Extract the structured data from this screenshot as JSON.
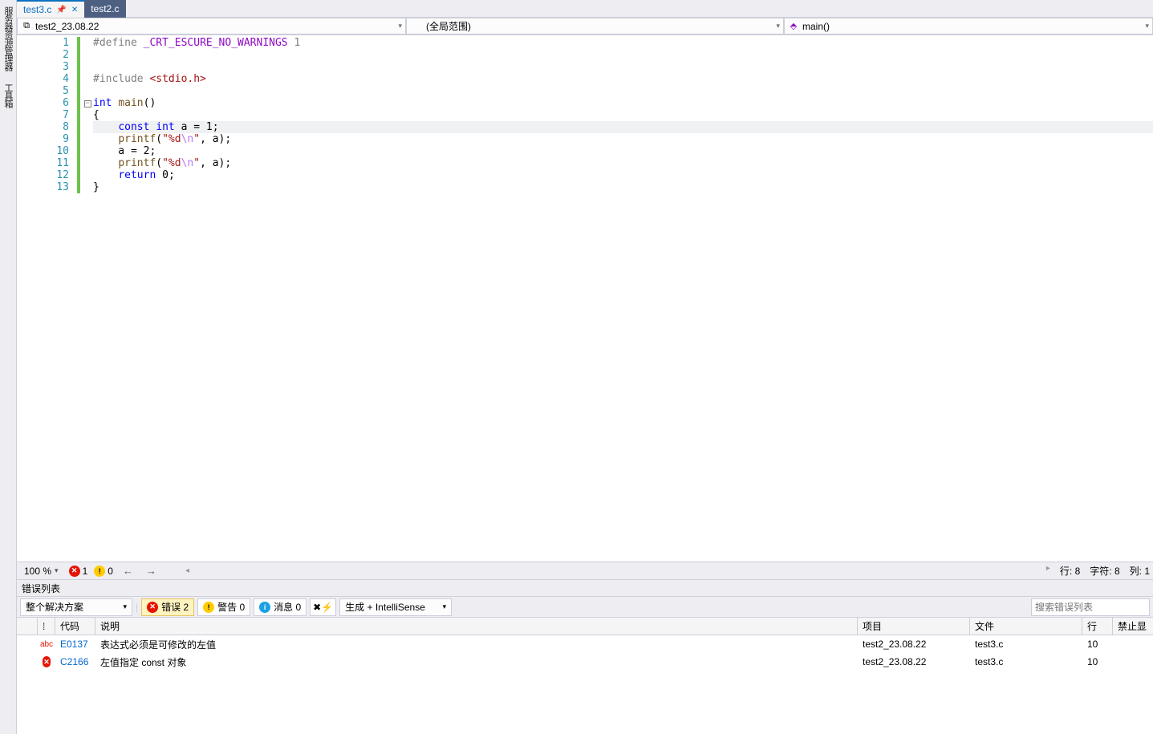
{
  "sidebar": {
    "tabs": [
      "服务器资源管理器",
      "工具箱"
    ]
  },
  "fileTabs": [
    {
      "label": "test3.c",
      "selected": true,
      "pinned": true
    },
    {
      "label": "test2.c",
      "selected": false
    }
  ],
  "nav": {
    "project": "test2_23.08.22",
    "scope": "(全局范围)",
    "member": "main()"
  },
  "code": {
    "lines": 13,
    "highlight": 8,
    "src": [
      {
        "t": [
          [
            "macro",
            "#define "
          ],
          [
            "pp",
            "_CRT_ESCURE_NO_WARNINGS"
          ],
          [
            "macro",
            " 1"
          ]
        ]
      },
      {
        "t": []
      },
      {
        "t": []
      },
      {
        "t": [
          [
            "macro",
            "#include "
          ],
          [
            "str",
            "<stdio.h>"
          ]
        ]
      },
      {
        "t": []
      },
      {
        "t": [
          [
            "kw",
            "int"
          ],
          [
            "txt",
            " "
          ],
          [
            "fn",
            "main"
          ],
          [
            "txt",
            "()"
          ]
        ]
      },
      {
        "t": [
          [
            "txt",
            "{"
          ]
        ]
      },
      {
        "t": [
          [
            "txt",
            "    "
          ],
          [
            "kw",
            "const"
          ],
          [
            "txt",
            " "
          ],
          [
            "kw",
            "int"
          ],
          [
            "txt",
            " a = "
          ],
          [
            "num",
            "1"
          ],
          [
            "txt",
            ";"
          ]
        ]
      },
      {
        "t": [
          [
            "txt",
            "    "
          ],
          [
            "fn",
            "printf"
          ],
          [
            "txt",
            "("
          ],
          [
            "str",
            "\"%d"
          ],
          [
            "esc",
            "\\n"
          ],
          [
            "str",
            "\""
          ],
          [
            "txt",
            ", a);"
          ]
        ]
      },
      {
        "t": [
          [
            "txt",
            "    a = "
          ],
          [
            "num",
            "2"
          ],
          [
            "txt",
            ";"
          ]
        ]
      },
      {
        "t": [
          [
            "txt",
            "    "
          ],
          [
            "fn",
            "printf"
          ],
          [
            "txt",
            "("
          ],
          [
            "str",
            "\"%d"
          ],
          [
            "esc",
            "\\n"
          ],
          [
            "str",
            "\""
          ],
          [
            "txt",
            ", a);"
          ]
        ]
      },
      {
        "t": [
          [
            "txt",
            "    "
          ],
          [
            "kw",
            "return"
          ],
          [
            "txt",
            " "
          ],
          [
            "num",
            "0"
          ],
          [
            "txt",
            ";"
          ]
        ]
      },
      {
        "t": [
          [
            "txt",
            "}"
          ]
        ]
      }
    ]
  },
  "status": {
    "zoom": "100 %",
    "errors": "1",
    "warnings": "0",
    "line_label": "行:",
    "line": "8",
    "char_label": "字符:",
    "char": "8",
    "col_label": "列:",
    "col": "1"
  },
  "errorPanel": {
    "title": "错误列表",
    "scope": "整个解决方案",
    "errorsBtn": "错误 2",
    "warnBtn": "警告 0",
    "infoBtn": "消息 0",
    "sourceFilter": "生成 + IntelliSense",
    "searchPlaceholder": "搜索错误列表",
    "headers": {
      "code": "代码",
      "desc": "说明",
      "proj": "项目",
      "file": "文件",
      "line": "行",
      "supp": "禁止显"
    },
    "rows": [
      {
        "sev": "abc",
        "code": "E0137",
        "desc": "表达式必须是可修改的左值",
        "proj": "test2_23.08.22",
        "file": "test3.c",
        "line": "10"
      },
      {
        "sev": "err",
        "code": "C2166",
        "desc": "左值指定 const 对象",
        "proj": "test2_23.08.22",
        "file": "test3.c",
        "line": "10"
      }
    ]
  }
}
